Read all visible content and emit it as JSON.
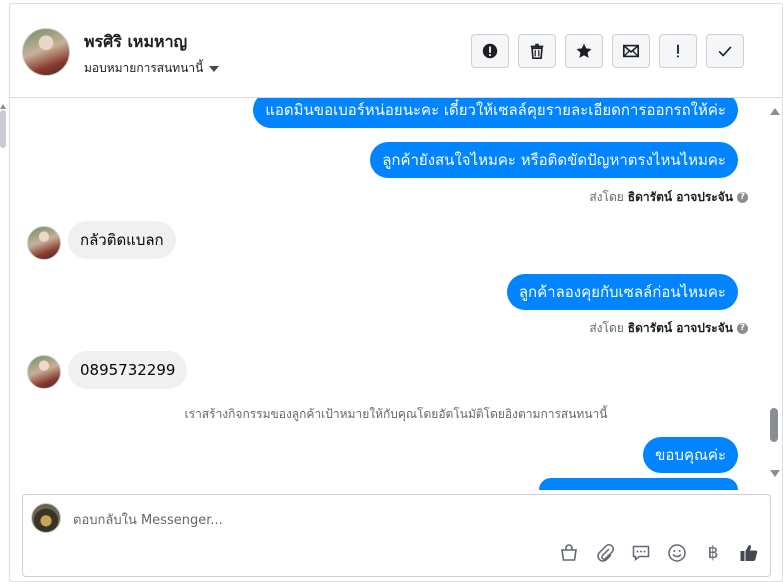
{
  "header": {
    "contact_name": "พรศิริ เหมหาญ",
    "assign_label": "มอบหมายการสนทนานี้",
    "actions": [
      {
        "name": "mark-spam-button",
        "icon": "alert-circle-icon"
      },
      {
        "name": "delete-button",
        "icon": "trash-icon"
      },
      {
        "name": "star-button",
        "icon": "star-icon"
      },
      {
        "name": "mark-unread-button",
        "icon": "envelope-icon"
      },
      {
        "name": "follow-up-button",
        "icon": "exclamation-icon"
      },
      {
        "name": "mark-done-button",
        "icon": "check-icon"
      }
    ]
  },
  "messages": {
    "m1": "แอดมินขอเบอร์หน่อยนะคะ เดี๋ยวให้เซลล์คุยรายละเอียดการออกรถให้ค่ะ",
    "m2": "ลูกค้ายังสนใจไหมคะ หรือติดขัดปัญหาตรงไหนไหมคะ",
    "sent_by_prefix_1": "ส่งโดย",
    "sent_by_name_1": "ธิดารัตน์ อาจประจัน",
    "m3": "กลัวติดแบลก",
    "m4": "ลูกค้าลองคุยกับเซลล์ก่อนไหมคะ",
    "sent_by_prefix_2": "ส่งโดย",
    "sent_by_name_2": "ธิดารัตน์ อาจประจัน",
    "m5": "0895732299",
    "system_note": "เราสร้างกิจกรรมของลูกค้าเป้าหมายให้กับคุณโดยอัตโนมัติโดยอิงตามการสนทนานี้",
    "m6": "ขอบคุณค่ะ"
  },
  "composer": {
    "placeholder": "ตอบกลับใน Messenger...",
    "tools": [
      "shopping-bag-icon",
      "paperclip-icon",
      "saved-replies-icon",
      "emoji-icon",
      "baht-payment-icon",
      "thumbs-up-icon"
    ],
    "baht_symbol": "฿"
  }
}
